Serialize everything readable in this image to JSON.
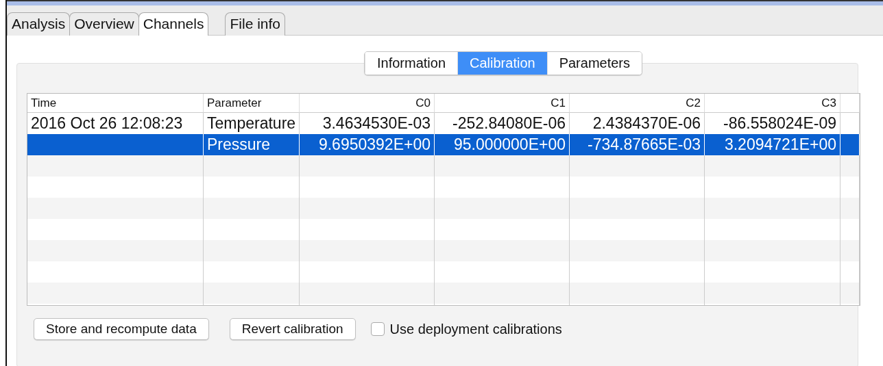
{
  "tabs": [
    {
      "label": "Analysis",
      "selected": false
    },
    {
      "label": "Overview",
      "selected": false
    },
    {
      "label": "Channels",
      "selected": true
    },
    {
      "label": "File info",
      "selected": false
    }
  ],
  "segments": [
    {
      "label": "Information",
      "selected": false
    },
    {
      "label": "Calibration",
      "selected": true
    },
    {
      "label": "Parameters",
      "selected": false
    }
  ],
  "table": {
    "columns": [
      "Time",
      "Parameter",
      "C0",
      "C1",
      "C2",
      "C3"
    ],
    "rows": [
      {
        "selected": false,
        "cells": [
          "2016 Oct 26 12:08:23",
          "Temperature",
          "3.4634530E-03",
          "-252.84080E-06",
          "2.4384370E-06",
          "-86.558024E-09"
        ]
      },
      {
        "selected": true,
        "cells": [
          "",
          "Pressure",
          "9.6950392E+00",
          "95.000000E+00",
          "-734.87665E-03",
          "3.2094721E+00"
        ]
      }
    ]
  },
  "buttons": [
    "Store and recompute data",
    "Revert calibration"
  ],
  "checkbox": {
    "label": "Use deployment calibrations",
    "checked": false
  }
}
